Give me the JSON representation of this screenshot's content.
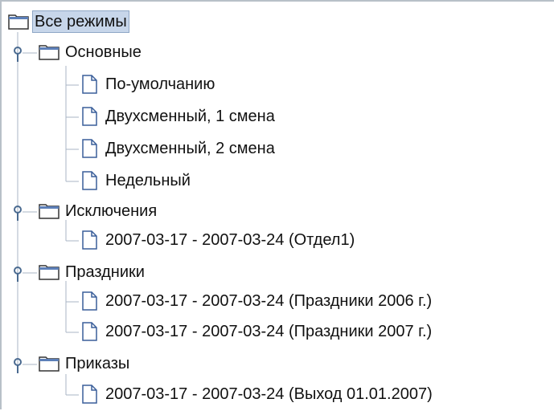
{
  "tree": {
    "root": {
      "label": "Все режимы",
      "selected": true,
      "icon": "folder-icon"
    },
    "groups": [
      {
        "label": "Основные",
        "icon": "folder-icon",
        "expanded": true,
        "items": [
          {
            "label": "По-умолчанию",
            "icon": "document-icon"
          },
          {
            "label": "Двухсменный, 1 смена",
            "icon": "document-icon"
          },
          {
            "label": "Двухсменный, 2 смена",
            "icon": "document-icon"
          },
          {
            "label": "Недельный",
            "icon": "document-icon"
          }
        ]
      },
      {
        "label": "Исключения",
        "icon": "folder-icon",
        "expanded": true,
        "items": [
          {
            "label": "2007-03-17 - 2007-03-24 (Отдел1)",
            "icon": "document-icon"
          }
        ]
      },
      {
        "label": "Праздники",
        "icon": "folder-icon",
        "expanded": true,
        "items": [
          {
            "label": "2007-03-17 - 2007-03-24 (Праздники 2006 г.)",
            "icon": "document-icon"
          },
          {
            "label": "2007-03-17 - 2007-03-24 (Праздники 2007 г.)",
            "icon": "document-icon"
          }
        ]
      },
      {
        "label": "Приказы",
        "icon": "folder-icon",
        "expanded": true,
        "items": [
          {
            "label": "2007-03-17 - 2007-03-24 (Выход 01.01.2007)",
            "icon": "document-icon"
          }
        ]
      }
    ]
  },
  "colors": {
    "selection_bg": "#c7d6ea",
    "tree_line": "#a8b4c4",
    "handle": "#4a6a90"
  }
}
